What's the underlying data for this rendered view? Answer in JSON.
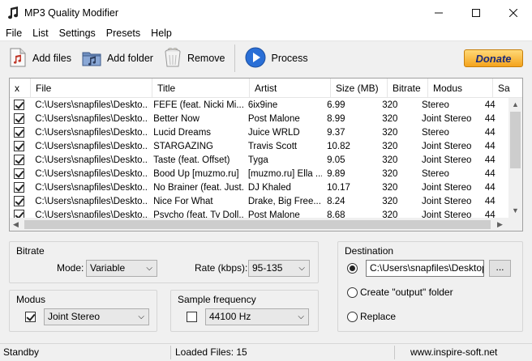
{
  "window": {
    "title": "MP3 Quality Modifier"
  },
  "menu": [
    "File",
    "List",
    "Settings",
    "Presets",
    "Help"
  ],
  "toolbar": {
    "add_files": "Add files",
    "add_folder": "Add folder",
    "remove": "Remove",
    "process": "Process",
    "donate": "Donate"
  },
  "table": {
    "columns": [
      "x",
      "File",
      "Title",
      "Artist",
      "Size  (MB)",
      "Bitrate",
      "Modus",
      "Sa"
    ],
    "rows": [
      {
        "checked": true,
        "file": "C:\\Users\\snapfiles\\Deskto...",
        "title": "FEFE (feat. Nicki Mi...",
        "artist": "6ix9ine",
        "size": "6.99",
        "bitrate": "320",
        "modus": "Stereo",
        "sa": "44"
      },
      {
        "checked": true,
        "file": "C:\\Users\\snapfiles\\Deskto...",
        "title": "Better Now",
        "artist": "Post Malone",
        "size": "8.99",
        "bitrate": "320",
        "modus": "Joint Stereo",
        "sa": "44"
      },
      {
        "checked": true,
        "file": "C:\\Users\\snapfiles\\Deskto...",
        "title": "Lucid Dreams",
        "artist": "Juice WRLD",
        "size": "9.37",
        "bitrate": "320",
        "modus": "Stereo",
        "sa": "44"
      },
      {
        "checked": true,
        "file": "C:\\Users\\snapfiles\\Deskto...",
        "title": "STARGAZING",
        "artist": "Travis Scott",
        "size": "10.82",
        "bitrate": "320",
        "modus": "Joint Stereo",
        "sa": "44"
      },
      {
        "checked": true,
        "file": "C:\\Users\\snapfiles\\Deskto...",
        "title": "Taste (feat. Offset)",
        "artist": "Tyga",
        "size": "9.05",
        "bitrate": "320",
        "modus": "Joint Stereo",
        "sa": "44"
      },
      {
        "checked": true,
        "file": "C:\\Users\\snapfiles\\Deskto...",
        "title": "Bood Up [muzmo.ru]",
        "artist": "[muzmo.ru] Ella ...",
        "size": "9.89",
        "bitrate": "320",
        "modus": "Stereo",
        "sa": "44"
      },
      {
        "checked": true,
        "file": "C:\\Users\\snapfiles\\Deskto...",
        "title": "No Brainer (feat. Just...",
        "artist": "DJ Khaled",
        "size": "10.17",
        "bitrate": "320",
        "modus": "Joint Stereo",
        "sa": "44"
      },
      {
        "checked": true,
        "file": "C:\\Users\\snapfiles\\Deskto...",
        "title": "Nice For What",
        "artist": "Drake, Big Free...",
        "size": "8.24",
        "bitrate": "320",
        "modus": "Joint Stereo",
        "sa": "44"
      },
      {
        "checked": true,
        "file": "C:\\Users\\snapfiles\\Deskto...",
        "title": "Psycho (feat. Ty Doll...",
        "artist": "Post Malone",
        "size": "8.68",
        "bitrate": "320",
        "modus": "Joint Stereo",
        "sa": "44"
      }
    ]
  },
  "bitrate": {
    "group_label": "Bitrate",
    "mode_label": "Mode:",
    "mode_value": "Variable",
    "rate_label": "Rate (kbps):",
    "rate_value": "95-135"
  },
  "modus": {
    "group_label": "Modus",
    "checked": true,
    "value": "Joint Stereo"
  },
  "sample_frequency": {
    "group_label": "Sample frequency",
    "checked": false,
    "value": "44100 Hz"
  },
  "destination": {
    "group_label": "Destination",
    "path": "C:\\Users\\snapfiles\\Desktop\\",
    "browse_label": "...",
    "create_output_label": "Create \"output\" folder",
    "replace_label": "Replace",
    "selected": "path"
  },
  "status": {
    "state": "Standby",
    "loaded": "Loaded Files: 15",
    "website": "www.inspire-soft.net"
  },
  "colors": {
    "accent_blue": "#2a6fd6",
    "donate_orange": "#f4a31d"
  }
}
